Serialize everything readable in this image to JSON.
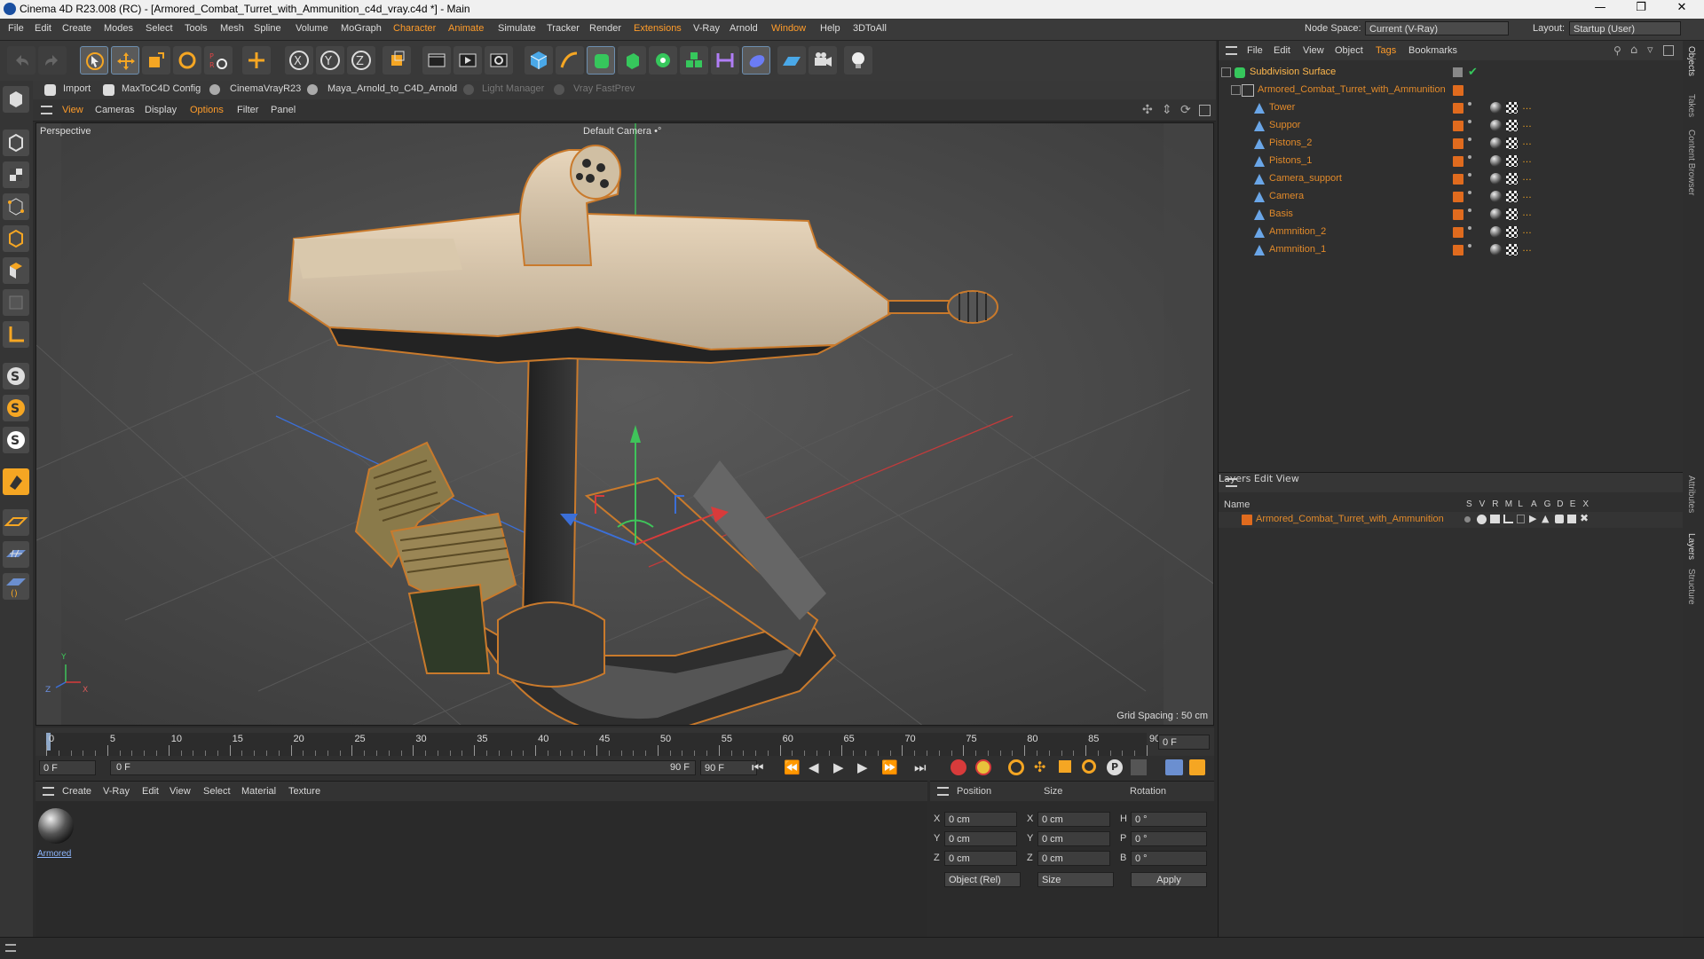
{
  "window": {
    "title": "Cinema 4D R23.008 (RC) - [Armored_Combat_Turret_with_Ammunition_c4d_vray.c4d *] - Main"
  },
  "menubar": {
    "items": [
      "File",
      "Edit",
      "Create",
      "Modes",
      "Select",
      "Tools",
      "Mesh",
      "Spline",
      "Volume",
      "MoGraph",
      "Character",
      "Animate",
      "Simulate",
      "Tracker",
      "Render",
      "Extensions",
      "V-Ray",
      "Arnold",
      "Window",
      "Help",
      "3DToAll"
    ],
    "node_space_label": "Node Space:",
    "node_space_value": "Current (V-Ray)",
    "layout_label": "Layout:",
    "layout_value": "Startup (User)"
  },
  "pluginbar": {
    "items": [
      "Import",
      "MaxToC4D Config",
      "CinemaVrayR23",
      "Maya_Arnold_to_C4D_Arnold",
      "Light Manager",
      "Vray FastPrev"
    ]
  },
  "viewport": {
    "menu": [
      "View",
      "Cameras",
      "Display",
      "Options",
      "Filter",
      "Panel"
    ],
    "label": "Perspective",
    "camera": "Default Camera",
    "camera_suffix": "•°",
    "grid_spacing": "Grid Spacing : 50 cm",
    "axis_y": "Y",
    "axis_z": "Z",
    "axis_x": "X"
  },
  "timeline": {
    "ticks": [
      "0",
      "5",
      "10",
      "15",
      "20",
      "25",
      "30",
      "35",
      "40",
      "45",
      "50",
      "55",
      "60",
      "65",
      "70",
      "75",
      "80",
      "85",
      "90"
    ],
    "frame_end_display": "0 F",
    "current_frame": "0 F",
    "range_start": "0 F",
    "range_end": "90 F",
    "max_frame": "90 F"
  },
  "material_manager": {
    "menu": [
      "Create",
      "V-Ray",
      "Edit",
      "View",
      "Select",
      "Material",
      "Texture"
    ],
    "material_name": "Armored"
  },
  "coordinates": {
    "headers": [
      "Position",
      "Size",
      "Rotation"
    ],
    "rows": [
      {
        "axis": "X",
        "pos": "0 cm",
        "size_axis": "X",
        "size": "0 cm",
        "rot_axis": "H",
        "rot": "0 °"
      },
      {
        "axis": "Y",
        "pos": "0 cm",
        "size_axis": "Y",
        "size": "0 cm",
        "rot_axis": "P",
        "rot": "0 °"
      },
      {
        "axis": "Z",
        "pos": "0 cm",
        "size_axis": "Z",
        "size": "0 cm",
        "rot_axis": "B",
        "rot": "0 °"
      }
    ],
    "mode": "Object (Rel)",
    "size_mode": "Size",
    "apply": "Apply"
  },
  "object_manager": {
    "menu": [
      "File",
      "Edit",
      "View",
      "Object",
      "Tags",
      "Bookmarks"
    ],
    "root": "Subdivision Surface",
    "group": "Armored_Combat_Turret_with_Ammunition",
    "children": [
      "Tower",
      "Suppor",
      "Pistons_2",
      "Pistons_1",
      "Camera_support",
      "Camera",
      "Basis",
      "Ammnition_2",
      "Ammnition_1"
    ]
  },
  "layers": {
    "menu": [
      "Layers",
      "Edit",
      "View"
    ],
    "col_name": "Name",
    "cols": [
      "S",
      "V",
      "R",
      "M",
      "L",
      "A",
      "G",
      "D",
      "E",
      "X"
    ],
    "layer_name": "Armored_Combat_Turret_with_Ammunition"
  },
  "side_tabs": [
    "Objects",
    "Takes",
    "Content Browser",
    "Attributes",
    "Layers",
    "Structure"
  ],
  "colors": {
    "accent_orange": "#ff9c2a",
    "object_name_orange": "#e28a2a",
    "viewport_bg": "#4b4b4b",
    "axis_green": "#3fc45a",
    "axis_red": "#d83b3b",
    "axis_blue": "#3b6fd8"
  }
}
